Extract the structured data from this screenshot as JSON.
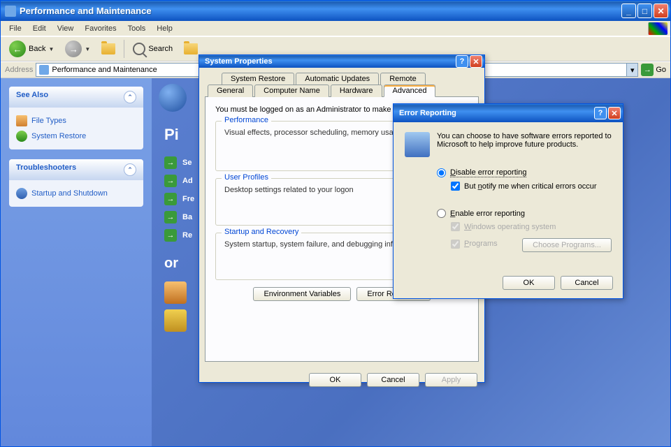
{
  "window": {
    "title": "Performance and Maintenance"
  },
  "menu": {
    "file": "File",
    "edit": "Edit",
    "view": "View",
    "favorites": "Favorites",
    "tools": "Tools",
    "help": "Help"
  },
  "toolbar": {
    "back": "Back",
    "search": "Search"
  },
  "address": {
    "label": "Address",
    "value": "Performance and Maintenance",
    "go": "Go"
  },
  "sidebar": {
    "seeAlso": {
      "title": "See Also",
      "items": [
        "File Types",
        "System Restore"
      ]
    },
    "troubleshooters": {
      "title": "Troubleshooters",
      "items": [
        "Startup and Shutdown"
      ]
    }
  },
  "main": {
    "heading": "Pi",
    "tasks": [
      "Se",
      "Ad",
      "Fre",
      "Ba",
      "Re"
    ],
    "or": "or"
  },
  "sysprop": {
    "title": "System Properties",
    "tabsRow1": [
      "System Restore",
      "Automatic Updates",
      "Remote"
    ],
    "tabsRow2": [
      "General",
      "Computer Name",
      "Hardware",
      "Advanced"
    ],
    "adminNote": "You must be logged on as an Administrator to make mo",
    "perf": {
      "legend": "Performance",
      "desc": "Visual effects, processor scheduling, memory usage, a"
    },
    "prof": {
      "legend": "User Profiles",
      "desc": "Desktop settings related to your logon"
    },
    "startup": {
      "legend": "Startup and Recovery",
      "desc": "System startup, system failure, and debugging informat"
    },
    "envBtn": "Environment Variables",
    "errBtn": "Error Reporting",
    "ok": "OK",
    "cancel": "Cancel",
    "apply": "Apply"
  },
  "err": {
    "title": "Error Reporting",
    "intro": "You can choose to have software errors reported to Microsoft to help improve future products.",
    "disable": "Disable error reporting",
    "notify": "But notify me when critical errors occur",
    "enable": "Enable error reporting",
    "winos": "Windows operating system",
    "programs": "Programs",
    "choose": "Choose Programs...",
    "ok": "OK",
    "cancel": "Cancel"
  }
}
